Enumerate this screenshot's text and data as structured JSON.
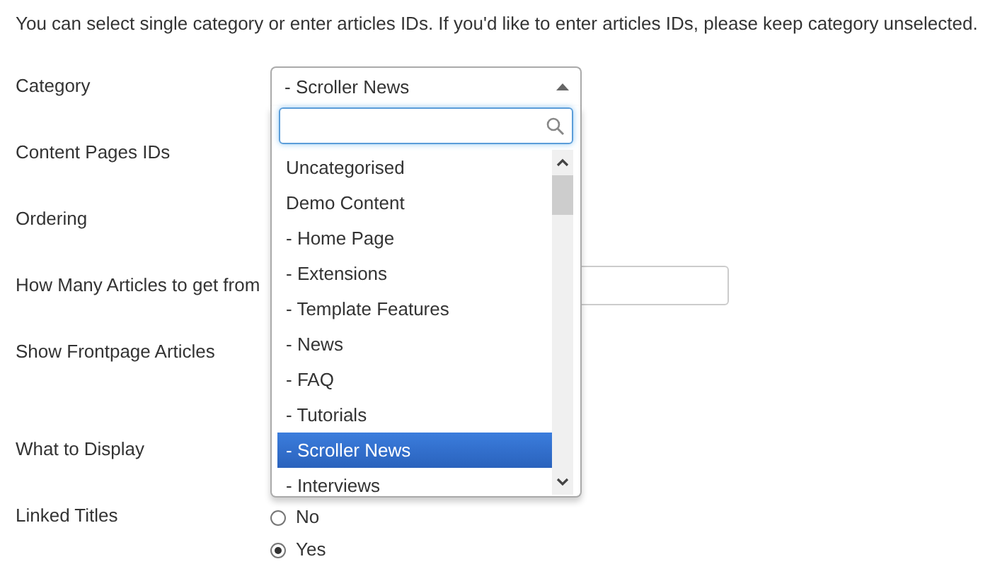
{
  "description": "You can select single category or enter articles IDs. If you'd like to enter articles IDs, please keep category unselected.",
  "fields": [
    {
      "label": "Category",
      "kind": "select",
      "value": "- Scroller News",
      "expanded": true,
      "options": [
        {
          "label": "Uncategorised",
          "selected": false
        },
        {
          "label": "Demo Content",
          "selected": false
        },
        {
          "label": "- Home Page",
          "selected": false
        },
        {
          "label": "- Extensions",
          "selected": false
        },
        {
          "label": "- Template Features",
          "selected": false
        },
        {
          "label": "- News",
          "selected": false
        },
        {
          "label": "- FAQ",
          "selected": false
        },
        {
          "label": "- Tutorials",
          "selected": false
        },
        {
          "label": "- Scroller News",
          "selected": true
        },
        {
          "label": "- Interviews",
          "selected": false
        }
      ]
    },
    {
      "label": "Content Pages IDs",
      "kind": "hidden"
    },
    {
      "label": "Ordering",
      "kind": "hidden"
    },
    {
      "label": "How Many Articles to get from",
      "kind": "text"
    },
    {
      "label": "Show Frontpage Articles",
      "kind": "hidden"
    },
    {
      "label": "What to Display",
      "kind": "hidden"
    },
    {
      "label": "Linked Titles",
      "kind": "radio",
      "options": [
        {
          "label": "No",
          "selected": false
        },
        {
          "label": "Yes",
          "selected": true
        }
      ]
    }
  ]
}
